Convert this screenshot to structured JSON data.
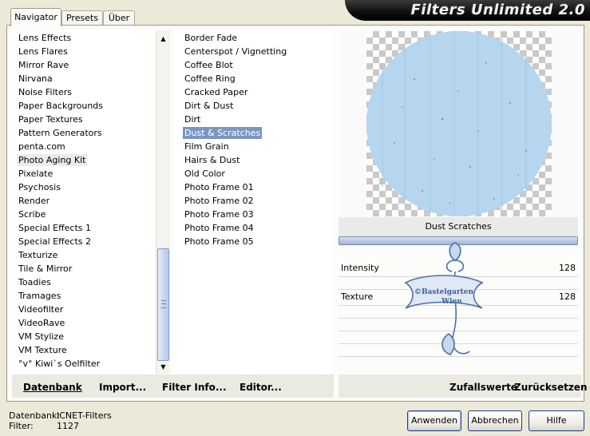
{
  "tabs": [
    {
      "label": "Navigator",
      "active": true
    },
    {
      "label": "Presets",
      "active": false
    },
    {
      "label": "Über",
      "active": false
    }
  ],
  "banner_title": "Filters Unlimited 2.0",
  "categories": [
    "Lens Effects",
    "Lens Flares",
    "Mirror Rave",
    "Nirvana",
    "Noise Filters",
    "Paper Backgrounds",
    "Paper Textures",
    "Pattern Generators",
    "penta.com",
    "Photo Aging Kit",
    "Pixelate",
    "Psychosis",
    "Render",
    "Scribe",
    "Special Effects 1",
    "Special Effects 2",
    "Texturize",
    "Tile & Mirror",
    "Toadies",
    "Tramages",
    "Videofilter",
    "VideoRave",
    "VM Stylize",
    "VM Texture",
    "°v° Kiwi`s Oelfilter"
  ],
  "selected_category": "Photo Aging Kit",
  "filters": [
    "Border Fade",
    "Centerspot / Vignetting",
    "Coffee Blot",
    "Coffee Ring",
    "Cracked Paper",
    "Dirt & Dust",
    "Dirt",
    "Dust & Scratches",
    "Film Grain",
    "Hairs & Dust",
    "Old Color",
    "Photo Frame 01",
    "Photo Frame 02",
    "Photo Frame 03",
    "Photo Frame 04",
    "Photo Frame 05"
  ],
  "selected_filter": "Dust & Scratches",
  "effect_name": "Dust  Scratches",
  "params": [
    {
      "label": "Intensity",
      "value": "128"
    },
    {
      "label": "Texture",
      "value": "128"
    }
  ],
  "watermark": {
    "line1": "©Bastelgarten",
    "line2": "Wien"
  },
  "bottom_links": {
    "database": "Datenbank",
    "import": "Import...",
    "filter_info": "Filter Info...",
    "editor": "Editor...",
    "random": "Zufallswerte",
    "reset": "Zurücksetzen"
  },
  "status": {
    "database_label": "Datenbank:",
    "database_value": "ICNET-Filters",
    "filter_label": "Filter:",
    "filter_value": "1127"
  },
  "buttons": {
    "apply": "Anwenden",
    "cancel": "Abbrechen",
    "help": "Hilfe"
  },
  "colors": {
    "selection": "#7a96c2",
    "preview_fill": "#b5d6ee",
    "banner": "#111111"
  },
  "icons": {
    "scroll_up": "triangle-up",
    "scroll_down": "triangle-down"
  }
}
